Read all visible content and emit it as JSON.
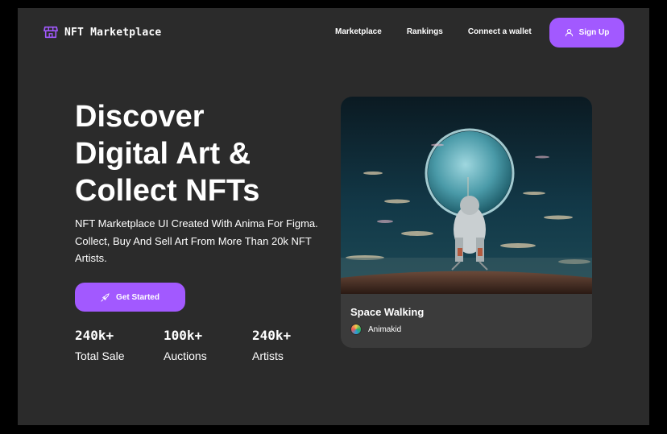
{
  "nav": {
    "brand": "NFT Marketplace",
    "links": [
      "Marketplace",
      "Rankings",
      "Connect a wallet"
    ],
    "signup_label": "Sign Up",
    "icons": {
      "logo": "storefront-icon",
      "signup": "user-icon"
    }
  },
  "hero": {
    "title_lines": [
      "Discover",
      "Digital Art &",
      "Collect NFTs"
    ],
    "subtitle": "NFT Marketplace UI Created With Anima For Figma. Collect, Buy And Sell Art From More Than 20k NFT Artists.",
    "cta_label": "Get Started",
    "cta_icon": "rocket-icon"
  },
  "stats": [
    {
      "value": "240k+",
      "label": "Total Sale"
    },
    {
      "value": "100k+",
      "label": "Auctions"
    },
    {
      "value": "240k+",
      "label": "Artists"
    }
  ],
  "featured": {
    "title": "Space Walking",
    "artist": "Animakid"
  },
  "colors": {
    "accent": "#a259ff",
    "background": "#2b2b2b",
    "card": "#3b3b3b",
    "outer": "#000000"
  }
}
